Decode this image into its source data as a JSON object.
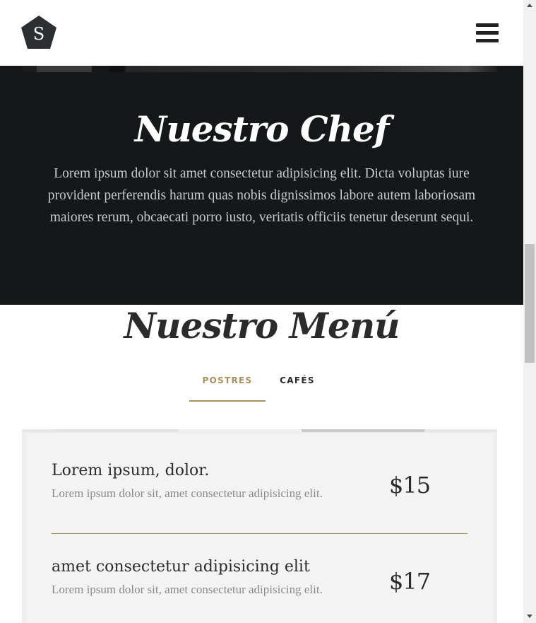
{
  "header": {
    "logo_letter": "S",
    "logo_color": "#2d2e30"
  },
  "chef": {
    "title": "Nuestro Chef",
    "text": "Lorem ipsum dolor sit amet consectetur adipisicing elit. Dicta voluptas iure provident perferendis harum quas nobis dignissimos labore autem laboriosam maiores rerum, obcaecati porro iusto, veritatis officiis tenetur deserunt sequi.",
    "background": "#161719"
  },
  "menu": {
    "title": "Nuestro Menú",
    "tabs": [
      {
        "label": "POSTRES",
        "active": true
      },
      {
        "label": "CAFÉS",
        "active": false
      }
    ],
    "items": [
      {
        "name": "Lorem ipsum, dolor.",
        "description": "Lorem ipsum dolor sit, amet consectetur adipisicing elit.",
        "price": "$15"
      },
      {
        "name": "amet consectetur adipisicing elit",
        "description": "Lorem ipsum dolor sit, amet consectetur adipisicing elit.",
        "price": "$17"
      }
    ]
  },
  "colors": {
    "accent": "#a8905c",
    "text_dark": "#2b2b2b",
    "text_muted": "#8a8a8a"
  },
  "icons": {
    "logo": "pentagon-logo-icon",
    "menu": "hamburger-menu-icon"
  }
}
